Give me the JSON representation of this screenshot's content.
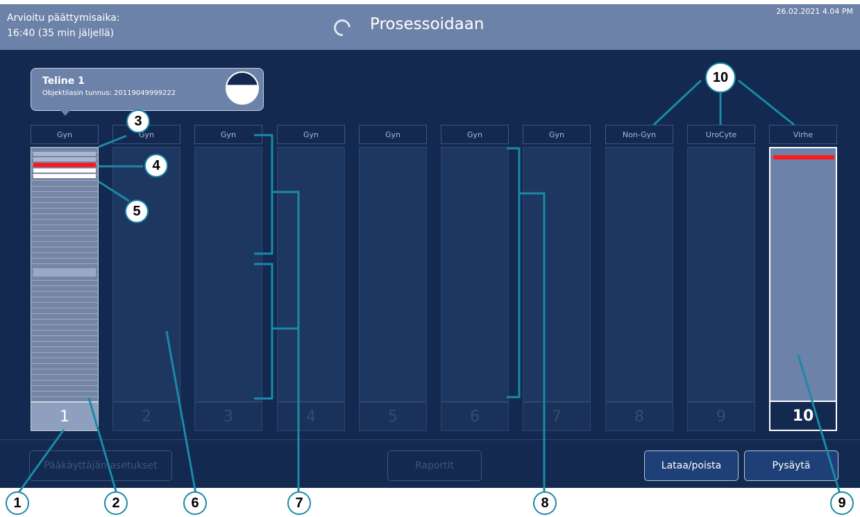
{
  "header": {
    "eta_label": "Arvioitu päättymisaika:",
    "eta_value": "16:40 (35 min jäljellä)",
    "title": "Prosessoidaan",
    "datetime": "26.02.2021 4.04 PM"
  },
  "tooltip": {
    "title": "Teline 1",
    "subtitle": "Objektilasin tunnus: 20119049999222"
  },
  "racks": [
    {
      "label": "Gyn",
      "number": "1"
    },
    {
      "label": "Gyn",
      "number": "2"
    },
    {
      "label": "Gyn",
      "number": "3"
    },
    {
      "label": "Gyn",
      "number": "4"
    },
    {
      "label": "Gyn",
      "number": "5"
    },
    {
      "label": "Gyn",
      "number": "6"
    },
    {
      "label": "Gyn",
      "number": "7"
    },
    {
      "label": "Non-Gyn",
      "number": "8"
    },
    {
      "label": "UroCyte",
      "number": "9"
    },
    {
      "label": "Virhe",
      "number": "10"
    }
  ],
  "buttons": {
    "admin": "Pääkäyttäjän asetukset",
    "reports": "Raportit",
    "load_unload": "Lataa/poista",
    "stop": "Pysäytä"
  },
  "callouts": [
    "1",
    "2",
    "3",
    "4",
    "5",
    "6",
    "7",
    "8",
    "9",
    "10"
  ],
  "colors": {
    "background": "#13294f",
    "header": "#6d82a8",
    "error": "#ff1a1a",
    "callout_line": "#1a8aa8"
  }
}
